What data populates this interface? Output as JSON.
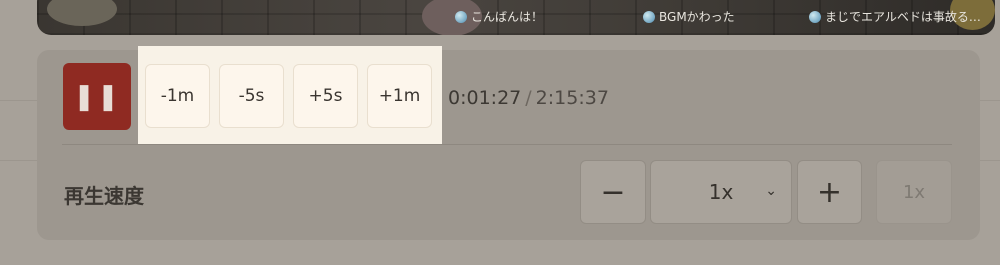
{
  "video": {
    "comments": [
      {
        "icon": "user-avatar-icon",
        "text": "こんばんは！"
      },
      {
        "icon": "user-avatar-icon",
        "text": "BGMかわった"
      },
      {
        "icon": "user-avatar-icon",
        "text": "まじでエアルベドは事故る…"
      }
    ]
  },
  "controls": {
    "pause_icon": "pause-icon",
    "pause_glyph": "❚❚",
    "seek_buttons": [
      {
        "label": "-1m"
      },
      {
        "label": "-5s"
      },
      {
        "label": "+5s"
      },
      {
        "label": "+1m"
      }
    ],
    "current_time": "0:01:27",
    "separator": "/",
    "total_time": "2:15:37"
  },
  "speed": {
    "label": "再生速度",
    "minus": "−",
    "selected": "1x",
    "plus": "+",
    "reset": "1x"
  },
  "colors": {
    "pause_button": "#8f2a22",
    "highlight": "#f8f2e7",
    "panel": "#9d978f"
  }
}
